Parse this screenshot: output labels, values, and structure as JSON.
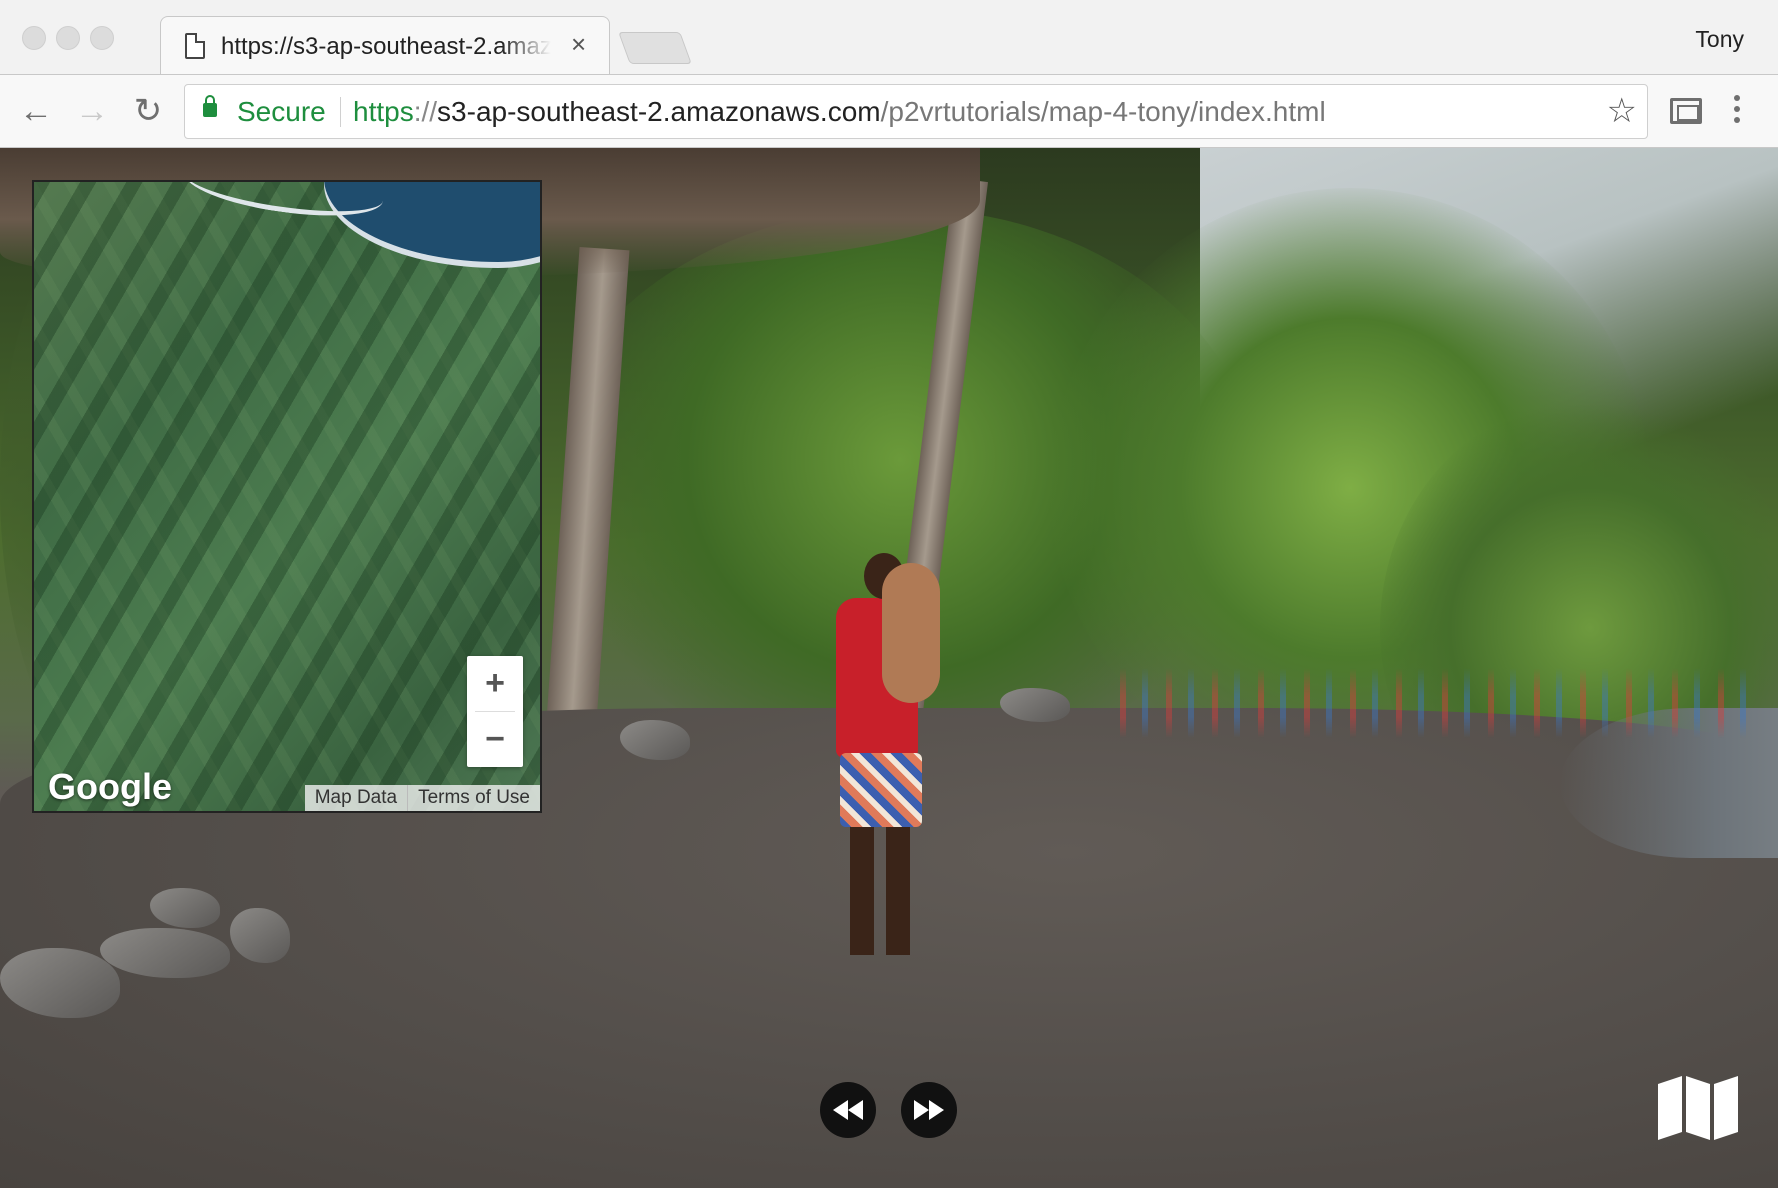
{
  "browser": {
    "tab": {
      "title": "https://s3-ap-southeast-2.amazonaws.com/p2vrtutorials/map-4-tony/index.html",
      "icon": "page-icon",
      "close": "×"
    },
    "profile_name": "Tony",
    "omnibox": {
      "secure_label": "Secure",
      "url_scheme": "https",
      "url_sep": "://",
      "url_host": "s3-ap-southeast-2.amazonaws.com",
      "url_path": "/p2vrtutorials/map-4-tony/index.html"
    },
    "nav": {
      "back": "←",
      "forward": "→",
      "reload": "↻",
      "bookmark": "☆"
    }
  },
  "map": {
    "provider_logo": "Google",
    "zoom_in": "+",
    "zoom_out": "−",
    "links": [
      "Map Data",
      "Terms of Use"
    ]
  },
  "tour_controls": {
    "previous": "rewind-icon",
    "next": "fast-forward-icon",
    "floorplan": "map-fold-icon"
  },
  "colors": {
    "secure_green": "#1e8e3e",
    "control_black": "#111111"
  }
}
